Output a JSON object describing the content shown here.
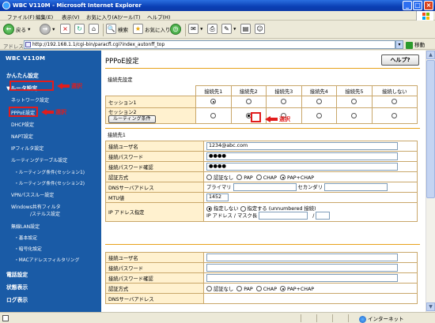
{
  "window": {
    "title": "WBC V110M - Microsoft Internet Explorer"
  },
  "menu": [
    "ファイル(F)",
    "編集(E)",
    "表示(V)",
    "お気に入り(A)",
    "ツール(T)",
    "ヘルプ(H)"
  ],
  "toolbar": {
    "back": "戻る",
    "search": "検索",
    "favorites": "お気に入り"
  },
  "address": {
    "label": "アドレス(D)",
    "url": "http://192.168.1.1/cgi-bin/paracfl.cgi?index_autonff_top",
    "go": "移動"
  },
  "sidebar": {
    "logo": "WBC V110M",
    "items": [
      "かんたん設定",
      "▼ルータ設定",
      "ネットワーク設定",
      "PPPoE設定",
      "DHCP設定",
      "NAPT設定",
      "IPフィルタ設定",
      "ルーティングテーブル設定",
      "・ルーティング条件(セッション1)",
      "・ルーティング条件(セッション2)",
      "VPNパススルー設定",
      "Windows共有フィルタ",
      "/ステルス設定",
      "無線LAN設定",
      "・基本設定",
      "・暗号化設定",
      "・MACアドレスフィルタリング",
      "電話設定",
      "状態表示",
      "ログ表示"
    ],
    "annotation": "選択"
  },
  "main": {
    "title": "PPPoE設定",
    "help": "ヘルプ?",
    "section1": "接続先設定",
    "headers": [
      "接続先1",
      "接続先2",
      "接続先3",
      "接続先4",
      "接続先5",
      "接続しない"
    ],
    "session1": "セッション1",
    "session2": "セッション2",
    "routing_button": "ルーティング条件",
    "annotation": "選択",
    "section2": "接続先1",
    "rows": {
      "user": "接続ユーザ名",
      "password": "接続パスワード",
      "password_confirm": "接続パスワード確認",
      "auth": "認証方式",
      "dns": "DNSサーバアドレス",
      "mtu": "MTU値",
      "ip": "IP アドレス指定"
    },
    "values": {
      "user": "1234@abc.com",
      "password": "●●●●",
      "password_confirm": "●●●●",
      "mtu": "1452"
    },
    "auth_options": [
      "認証なし",
      "PAP",
      "CHAP",
      "PAP+CHAP"
    ],
    "dns_primary": "プライマリ",
    "dns_secondary": "セカンダリ",
    "ip_options": [
      "指定しない",
      "指定する (unnumbered 接続)"
    ],
    "ip_mask_label": "IP アドレス / マスク長",
    "slash": "/"
  },
  "status": {
    "zone": "インターネット"
  }
}
